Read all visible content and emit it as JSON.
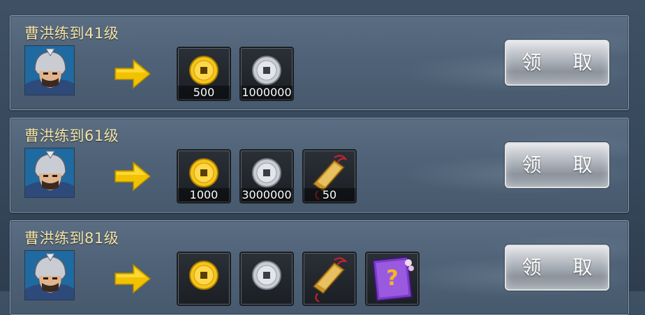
{
  "quests": [
    {
      "title": "曹洪练到41级",
      "claim_label": "领 取",
      "rewards": [
        {
          "type": "gold-coin",
          "icon": "gold-coin-icon",
          "qty": "500"
        },
        {
          "type": "silver-coin",
          "icon": "silver-coin-icon",
          "qty": "1000000"
        }
      ]
    },
    {
      "title": "曹洪练到61级",
      "claim_label": "领 取",
      "rewards": [
        {
          "type": "gold-coin",
          "icon": "gold-coin-icon",
          "qty": "1000"
        },
        {
          "type": "silver-coin",
          "icon": "silver-coin-icon",
          "qty": "3000000"
        },
        {
          "type": "token",
          "icon": "token-plaque-icon",
          "qty": "50"
        }
      ]
    },
    {
      "title": "曹洪练到81级",
      "claim_label": "领 取",
      "rewards": [
        {
          "type": "gold-coin",
          "icon": "gold-coin-icon",
          "qty": ""
        },
        {
          "type": "silver-coin",
          "icon": "silver-coin-icon",
          "qty": ""
        },
        {
          "type": "token",
          "icon": "token-plaque-icon",
          "qty": ""
        },
        {
          "type": "mystery-book",
          "icon": "mystery-book-icon",
          "qty": ""
        }
      ]
    }
  ],
  "colors": {
    "title": "#f3e3a6",
    "arrow": "#f2c200",
    "gold": "#f5c518",
    "silver": "#c9ccd1"
  }
}
